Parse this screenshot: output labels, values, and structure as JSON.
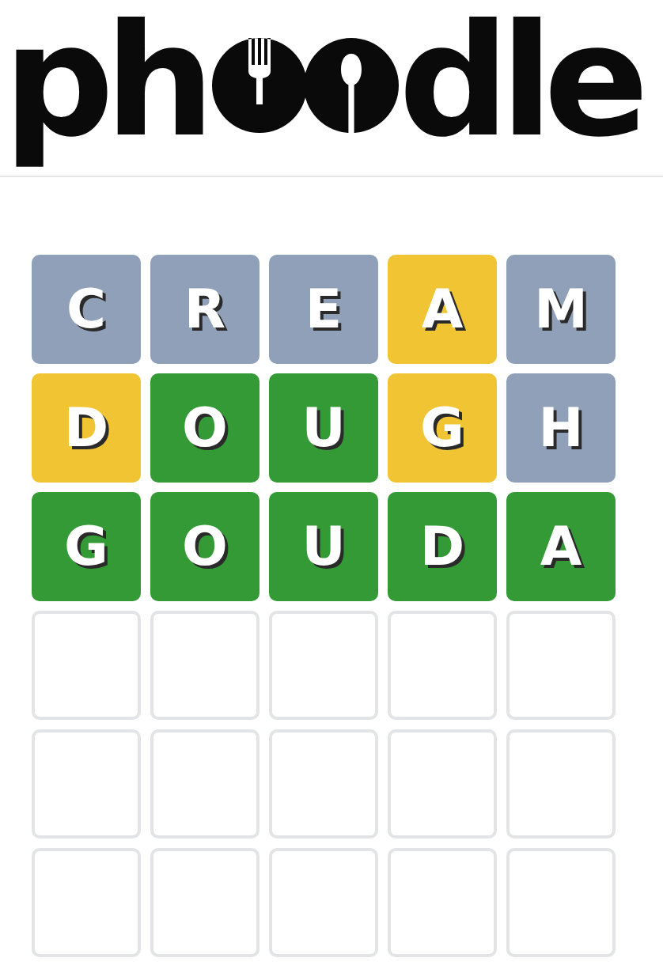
{
  "logo": {
    "start": "ph",
    "end": "dle"
  },
  "board": [
    {
      "tiles": [
        {
          "letter": "C",
          "kind": "absent"
        },
        {
          "letter": "R",
          "kind": "absent"
        },
        {
          "letter": "E",
          "kind": "absent"
        },
        {
          "letter": "A",
          "kind": "present"
        },
        {
          "letter": "M",
          "kind": "absent"
        }
      ]
    },
    {
      "tiles": [
        {
          "letter": "D",
          "kind": "present"
        },
        {
          "letter": "O",
          "kind": "correct"
        },
        {
          "letter": "U",
          "kind": "correct"
        },
        {
          "letter": "G",
          "kind": "present"
        },
        {
          "letter": "H",
          "kind": "absent"
        }
      ]
    },
    {
      "tiles": [
        {
          "letter": "G",
          "kind": "correct"
        },
        {
          "letter": "O",
          "kind": "correct"
        },
        {
          "letter": "U",
          "kind": "correct"
        },
        {
          "letter": "D",
          "kind": "correct"
        },
        {
          "letter": "A",
          "kind": "correct"
        }
      ]
    },
    {
      "tiles": [
        {
          "kind": "empty"
        },
        {
          "kind": "empty"
        },
        {
          "kind": "empty"
        },
        {
          "kind": "empty"
        },
        {
          "kind": "empty"
        }
      ]
    },
    {
      "tiles": [
        {
          "kind": "empty"
        },
        {
          "kind": "empty"
        },
        {
          "kind": "empty"
        },
        {
          "kind": "empty"
        },
        {
          "kind": "empty"
        }
      ]
    },
    {
      "tiles": [
        {
          "kind": "empty"
        },
        {
          "kind": "empty"
        },
        {
          "kind": "empty"
        },
        {
          "kind": "empty"
        },
        {
          "kind": "empty"
        }
      ]
    }
  ]
}
